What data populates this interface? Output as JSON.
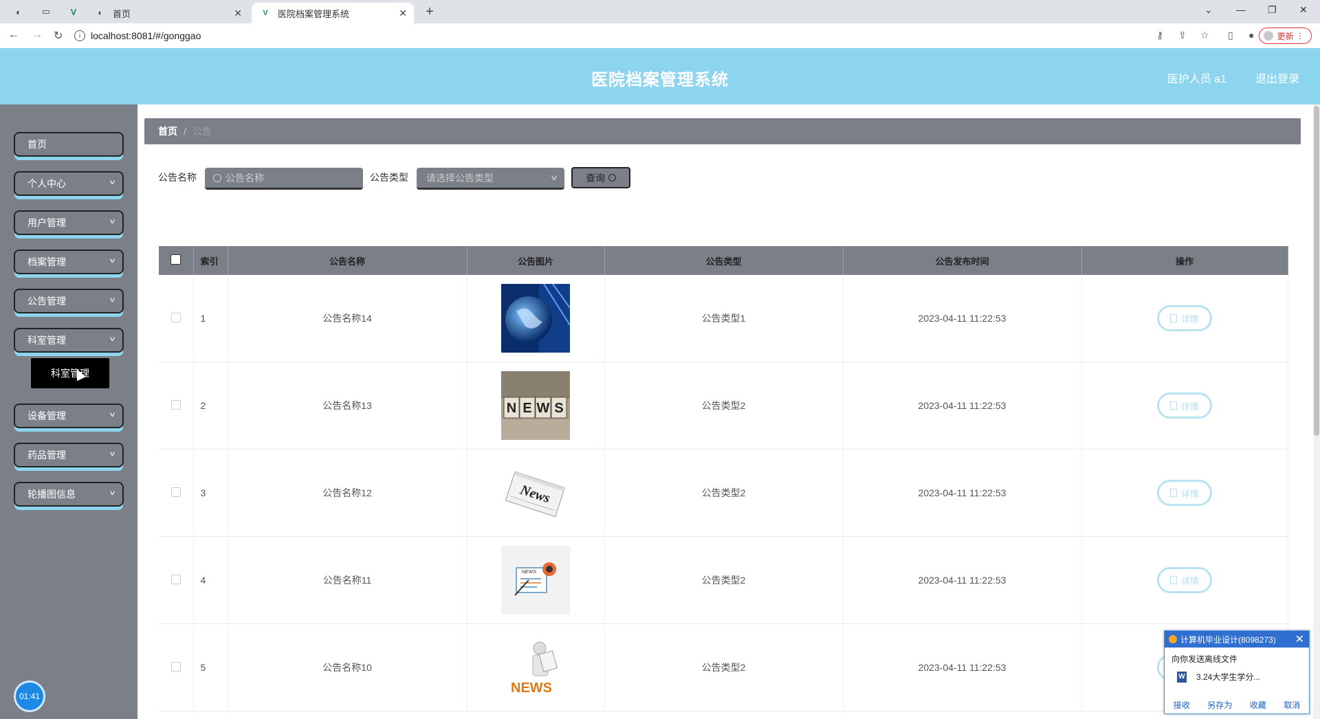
{
  "browser": {
    "tabs": [
      {
        "label": "首页",
        "active": false
      },
      {
        "label": "医院档案管理系统",
        "active": true
      }
    ],
    "new_tab": "+",
    "url": "localhost:8081/#/gonggao",
    "update_label": "更新"
  },
  "header": {
    "title": "医院档案管理系统",
    "user": "医护人员 a1",
    "logout": "退出登录"
  },
  "sidebar": {
    "items": [
      {
        "label": "首页"
      },
      {
        "label": "个人中心"
      },
      {
        "label": "用户管理"
      },
      {
        "label": "档案管理"
      },
      {
        "label": "公告管理"
      },
      {
        "label": "科室管理"
      },
      {
        "label": "设备管理"
      },
      {
        "label": "药品管理"
      },
      {
        "label": "轮播图信息"
      }
    ],
    "submenu_item": "科室管理",
    "clock": "01:41"
  },
  "breadcrumb": {
    "home": "首页",
    "separator": "/",
    "current": "公告"
  },
  "search": {
    "name_label": "公告名称",
    "name_placeholder": "公告名称",
    "type_label": "公告类型",
    "type_placeholder": "请选择公告类型",
    "query_label": "查询"
  },
  "table": {
    "headers": [
      "索引",
      "公告名称",
      "公告图片",
      "公告类型",
      "公告发布时间",
      "操作"
    ],
    "rows": [
      {
        "index": "1",
        "name": "公告名称14",
        "image": "globe-image",
        "type": "公告类型1",
        "time": "2023-04-11 11:22:53",
        "action": "详情"
      },
      {
        "index": "2",
        "name": "公告名称13",
        "image": "news-blocks-image",
        "type": "公告类型2",
        "time": "2023-04-11 11:22:53",
        "action": "详情"
      },
      {
        "index": "3",
        "name": "公告名称12",
        "image": "newspaper-image",
        "type": "公告类型2",
        "time": "2023-04-11 11:22:53",
        "action": "详情"
      },
      {
        "index": "4",
        "name": "公告名称11",
        "image": "news-icon-image",
        "type": "公告类型2",
        "time": "2023-04-11 11:22:53",
        "action": "详情"
      },
      {
        "index": "5",
        "name": "公告名称10",
        "image": "news-figure-image",
        "type": "公告类型2",
        "time": "2023-04-11 11:22:53",
        "action": "详情"
      }
    ]
  },
  "popup": {
    "title": "计算机毕业设计(8098273)",
    "message": "向你发送离线文件",
    "file": "3.24大学生学分...",
    "actions": [
      "接收",
      "另存为",
      "收藏",
      "取消"
    ]
  },
  "colors": {
    "header_bg": "#8dd4ef",
    "sidebar_bg": "#7b8088",
    "accent": "#8dd4ef"
  }
}
